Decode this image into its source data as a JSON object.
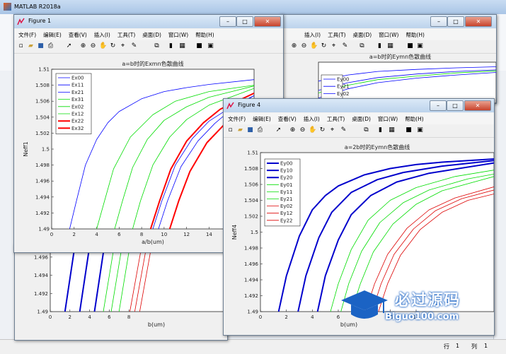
{
  "matlab": {
    "title": "MATLAB R2018a"
  },
  "menu": [
    "文件(F)",
    "编辑(E)",
    "查看(V)",
    "插入(I)",
    "工具(T)",
    "桌面(D)",
    "窗口(W)",
    "帮助(H)"
  ],
  "status": {
    "row_label": "行",
    "row_value": "1",
    "col_label": "列",
    "col_value": "1"
  },
  "watermark": {
    "text": "必过源码",
    "url": "Biguo100.com"
  },
  "figure1": {
    "title": "Figure 1"
  },
  "figure4": {
    "title": "Figure 4"
  },
  "chart_data": [
    {
      "id": "fig1",
      "type": "line",
      "title": "a=b时的Exmn色散曲线",
      "xlabel": "a/b(um)",
      "ylabel": "Neff1",
      "xlim": [
        0,
        18
      ],
      "ylim": [
        1.49,
        1.51
      ],
      "xticks": [
        "0",
        "2",
        "4",
        "6",
        "8",
        "10",
        "12",
        "14",
        "16"
      ],
      "yticks": [
        "1.49",
        "1.492",
        "1.494",
        "1.496",
        "1.498",
        "1.5",
        "1.502",
        "1.504",
        "1.506",
        "1.508",
        "1.51"
      ],
      "legend": "top-left",
      "series": [
        {
          "name": "Ex00",
          "color": "#0000ff",
          "width": 0.8,
          "x": [
            1.6,
            2.2,
            3,
            4,
            5,
            6,
            8,
            10,
            12,
            14,
            18
          ],
          "y": [
            1.49,
            1.4935,
            1.498,
            1.5012,
            1.5033,
            1.5047,
            1.5063,
            1.5072,
            1.5077,
            1.5081,
            1.5087
          ]
        },
        {
          "name": "Ex11",
          "color": "#0000ff",
          "width": 0.8,
          "x": [
            9,
            9.8,
            11,
            12.5,
            14,
            16,
            18
          ],
          "y": [
            1.49,
            1.4935,
            1.498,
            1.5013,
            1.5035,
            1.5053,
            1.5067
          ]
        },
        {
          "name": "Ex21",
          "color": "#0000ff",
          "width": 0.8,
          "x": [
            9.5,
            10.3,
            11.5,
            13,
            14.5,
            16,
            18
          ],
          "y": [
            1.49,
            1.4935,
            1.4978,
            1.501,
            1.5032,
            1.505,
            1.5067
          ]
        },
        {
          "name": "Ex31",
          "color": "#00dd00",
          "width": 0.8,
          "x": [
            4,
            4.7,
            5.5,
            7,
            9,
            11,
            14,
            18
          ],
          "y": [
            1.49,
            1.4935,
            1.4975,
            1.5015,
            1.5043,
            1.506,
            1.5072,
            1.508
          ]
        },
        {
          "name": "Ex02",
          "color": "#00dd00",
          "width": 0.8,
          "x": [
            5.6,
            6.3,
            7.2,
            8.5,
            10,
            12,
            14,
            18
          ],
          "y": [
            1.49,
            1.4935,
            1.4977,
            1.5012,
            1.5036,
            1.5053,
            1.5065,
            1.5079
          ]
        },
        {
          "name": "Ex12",
          "color": "#00dd00",
          "width": 0.8,
          "x": [
            7.2,
            7.9,
            9,
            10.5,
            12,
            14,
            18
          ],
          "y": [
            1.49,
            1.4935,
            1.498,
            1.5015,
            1.5037,
            1.5055,
            1.5076
          ]
        },
        {
          "name": "Ex22",
          "color": "#ff0000",
          "width": 2,
          "x": [
            8.8,
            9.6,
            10.6,
            12,
            13.5,
            15,
            18
          ],
          "y": [
            1.49,
            1.4935,
            1.4975,
            1.501,
            1.5033,
            1.505,
            1.507
          ]
        },
        {
          "name": "Ex32",
          "color": "#ff0000",
          "width": 2,
          "x": [
            10.5,
            11.3,
            12.3,
            13.8,
            15.3,
            17,
            18
          ],
          "y": [
            1.49,
            1.4935,
            1.4972,
            1.5008,
            1.503,
            1.5048,
            1.5055
          ]
        }
      ]
    },
    {
      "id": "fig4",
      "type": "line",
      "title": "a=2b时的Eymn色散曲线",
      "xlabel": "b(um)",
      "ylabel": "Neff4",
      "xlim": [
        0,
        18
      ],
      "ylim": [
        1.49,
        1.51
      ],
      "xticks": [
        "0",
        "2",
        "4",
        "6",
        "8",
        "10",
        "12"
      ],
      "yticks": [
        "1.49",
        "1.492",
        "1.494",
        "1.496",
        "1.498",
        "1.5",
        "1.502",
        "1.504",
        "1.506",
        "1.508",
        "1.51"
      ],
      "legend": "top-left",
      "series": [
        {
          "name": "Ey00",
          "color": "#0000cc",
          "width": 2,
          "x": [
            1.4,
            2,
            3,
            4,
            5,
            6,
            8,
            10,
            12,
            14,
            18
          ],
          "y": [
            1.49,
            1.4945,
            1.4995,
            1.5028,
            1.5046,
            1.5058,
            1.5072,
            1.508,
            1.5085,
            1.5088,
            1.5092
          ]
        },
        {
          "name": "Ey10",
          "color": "#0000cc",
          "width": 2,
          "x": [
            2.9,
            3.5,
            4.5,
            5.5,
            7,
            9,
            11,
            14,
            18
          ],
          "y": [
            1.49,
            1.4945,
            1.4993,
            1.5025,
            1.505,
            1.5066,
            1.5075,
            1.5083,
            1.509
          ]
        },
        {
          "name": "Ey20",
          "color": "#0000cc",
          "width": 2,
          "x": [
            4.4,
            5,
            6,
            7,
            8.5,
            10.5,
            13,
            18
          ],
          "y": [
            1.49,
            1.4945,
            1.499,
            1.5022,
            1.5046,
            1.5063,
            1.5074,
            1.5087
          ]
        },
        {
          "name": "Ey01",
          "color": "#00dd00",
          "width": 0.8,
          "x": [
            5.4,
            6,
            7,
            8.3,
            10,
            12,
            15,
            18
          ],
          "y": [
            1.49,
            1.4935,
            1.4978,
            1.5015,
            1.504,
            1.5056,
            1.507,
            1.5078
          ]
        },
        {
          "name": "Ey11",
          "color": "#00dd00",
          "width": 0.8,
          "x": [
            6.2,
            6.8,
            7.8,
            9.2,
            11,
            13,
            16,
            18
          ],
          "y": [
            1.49,
            1.4935,
            1.4976,
            1.5012,
            1.5037,
            1.5053,
            1.5067,
            1.5073
          ]
        },
        {
          "name": "Ey21",
          "color": "#00dd00",
          "width": 0.8,
          "x": [
            7,
            7.7,
            8.7,
            10.2,
            12,
            14,
            18
          ],
          "y": [
            1.49,
            1.4935,
            1.4975,
            1.501,
            1.5035,
            1.5052,
            1.507
          ]
        },
        {
          "name": "Ey02",
          "color": "#dd0000",
          "width": 0.8,
          "x": [
            8.1,
            8.8,
            9.8,
            11.3,
            13,
            15,
            18
          ],
          "y": [
            1.49,
            1.4935,
            1.4972,
            1.5005,
            1.5028,
            1.5043,
            1.5057
          ]
        },
        {
          "name": "Ey12",
          "color": "#dd0000",
          "width": 0.8,
          "x": [
            8.6,
            9.3,
            10.3,
            11.8,
            13.5,
            15.5,
            18
          ],
          "y": [
            1.49,
            1.4935,
            1.4972,
            1.5004,
            1.5027,
            1.5042,
            1.5053
          ]
        },
        {
          "name": "Ey22",
          "color": "#dd0000",
          "width": 0.8,
          "x": [
            9.1,
            9.8,
            10.8,
            12.3,
            14,
            16,
            18
          ],
          "y": [
            1.49,
            1.4935,
            1.4971,
            1.5003,
            1.5025,
            1.504,
            1.5048
          ]
        }
      ]
    },
    {
      "id": "bg",
      "type": "line",
      "xlabel": "b(um)",
      "xlim": [
        0,
        18
      ],
      "ylim": [
        1.49,
        1.497
      ],
      "xticks": [
        "0",
        "2",
        "4",
        "6",
        "8"
      ],
      "yticks": [
        "1.49",
        "1.492",
        "1.494",
        "1.496"
      ],
      "series": [
        {
          "color": "#0000cc",
          "width": 2,
          "x": [
            1.5,
            2.5
          ],
          "y": [
            1.49,
            1.4972
          ]
        },
        {
          "color": "#0000cc",
          "width": 2,
          "x": [
            3,
            4
          ],
          "y": [
            1.49,
            1.4972
          ]
        },
        {
          "color": "#0000cc",
          "width": 2,
          "x": [
            4.5,
            5.5
          ],
          "y": [
            1.49,
            1.4972
          ]
        },
        {
          "color": "#00dd00",
          "width": 0.8,
          "x": [
            5.4,
            6.5
          ],
          "y": [
            1.49,
            1.4972
          ]
        },
        {
          "color": "#00dd00",
          "width": 0.8,
          "x": [
            6.2,
            7.3
          ],
          "y": [
            1.49,
            1.4972
          ]
        },
        {
          "color": "#00dd00",
          "width": 0.8,
          "x": [
            7,
            8.1
          ],
          "y": [
            1.49,
            1.4972
          ]
        },
        {
          "color": "#dd0000",
          "width": 0.8,
          "x": [
            8.1,
            9.3
          ],
          "y": [
            1.49,
            1.4972
          ]
        },
        {
          "color": "#dd0000",
          "width": 0.8,
          "x": [
            8.6,
            9.8
          ],
          "y": [
            1.49,
            1.4972
          ]
        },
        {
          "color": "#dd0000",
          "width": 0.8,
          "x": [
            9.1,
            10.3
          ],
          "y": [
            1.49,
            1.4972
          ]
        }
      ]
    },
    {
      "id": "fig2",
      "type": "line",
      "title": "a=b时的Eymn色散曲线",
      "xlim": [
        0,
        18
      ],
      "ylim": [
        1.502,
        1.51
      ],
      "legend": "top-left",
      "series": [
        {
          "name": "Ey00",
          "color": "#0000ff",
          "width": 0.8,
          "x": [
            0,
            3,
            6,
            10,
            14,
            18
          ],
          "y": [
            1.5063,
            1.5075,
            1.5082,
            1.5086,
            1.5089,
            1.5091
          ]
        },
        {
          "name": "Ey21",
          "color": "#0000ff",
          "width": 0.8,
          "x": [
            0,
            3,
            6,
            10,
            14,
            18
          ],
          "y": [
            1.5045,
            1.506,
            1.507,
            1.5077,
            1.5082,
            1.5085
          ]
        },
        {
          "name": "Ey02",
          "color": "#0000ff",
          "width": 0.8,
          "x": [
            0,
            3,
            6,
            10,
            14,
            18
          ],
          "y": [
            1.503,
            1.5048,
            1.506,
            1.5069,
            1.5075,
            1.508
          ]
        },
        {
          "color": "#00dd00",
          "width": 0.8,
          "x": [
            0,
            3,
            6,
            10,
            14,
            18
          ],
          "y": [
            1.504,
            1.5055,
            1.5066,
            1.5073,
            1.5079,
            1.5083
          ]
        }
      ]
    }
  ]
}
